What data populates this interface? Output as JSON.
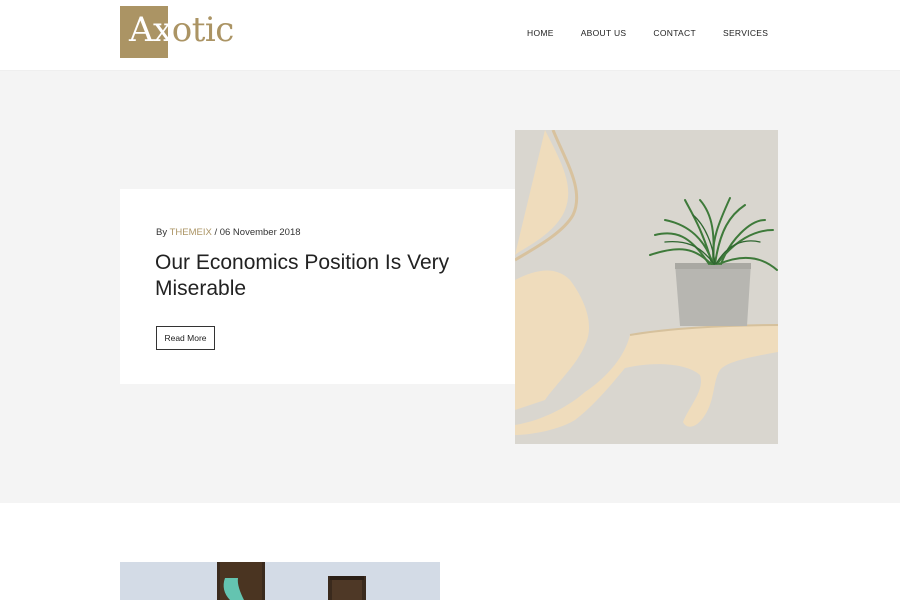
{
  "brand": {
    "logo_text_part1": "Ax",
    "logo_text_part2": "otic",
    "accent_color": "#ab9464"
  },
  "nav": {
    "items": [
      {
        "label": "HOME"
      },
      {
        "label": "ABOUT US"
      },
      {
        "label": "CONTACT"
      },
      {
        "label": "SERVICES"
      }
    ]
  },
  "post": {
    "meta_prefix": "By",
    "author": "THEMEIX",
    "meta_separator": "/",
    "date": "06 November 2018",
    "title": "Our Economics Position Is Very Miserable",
    "read_more_label": "Read More",
    "image_icon": "plant-on-branch-shelf-image"
  },
  "next_post": {
    "image_icon": "bottles-image"
  }
}
